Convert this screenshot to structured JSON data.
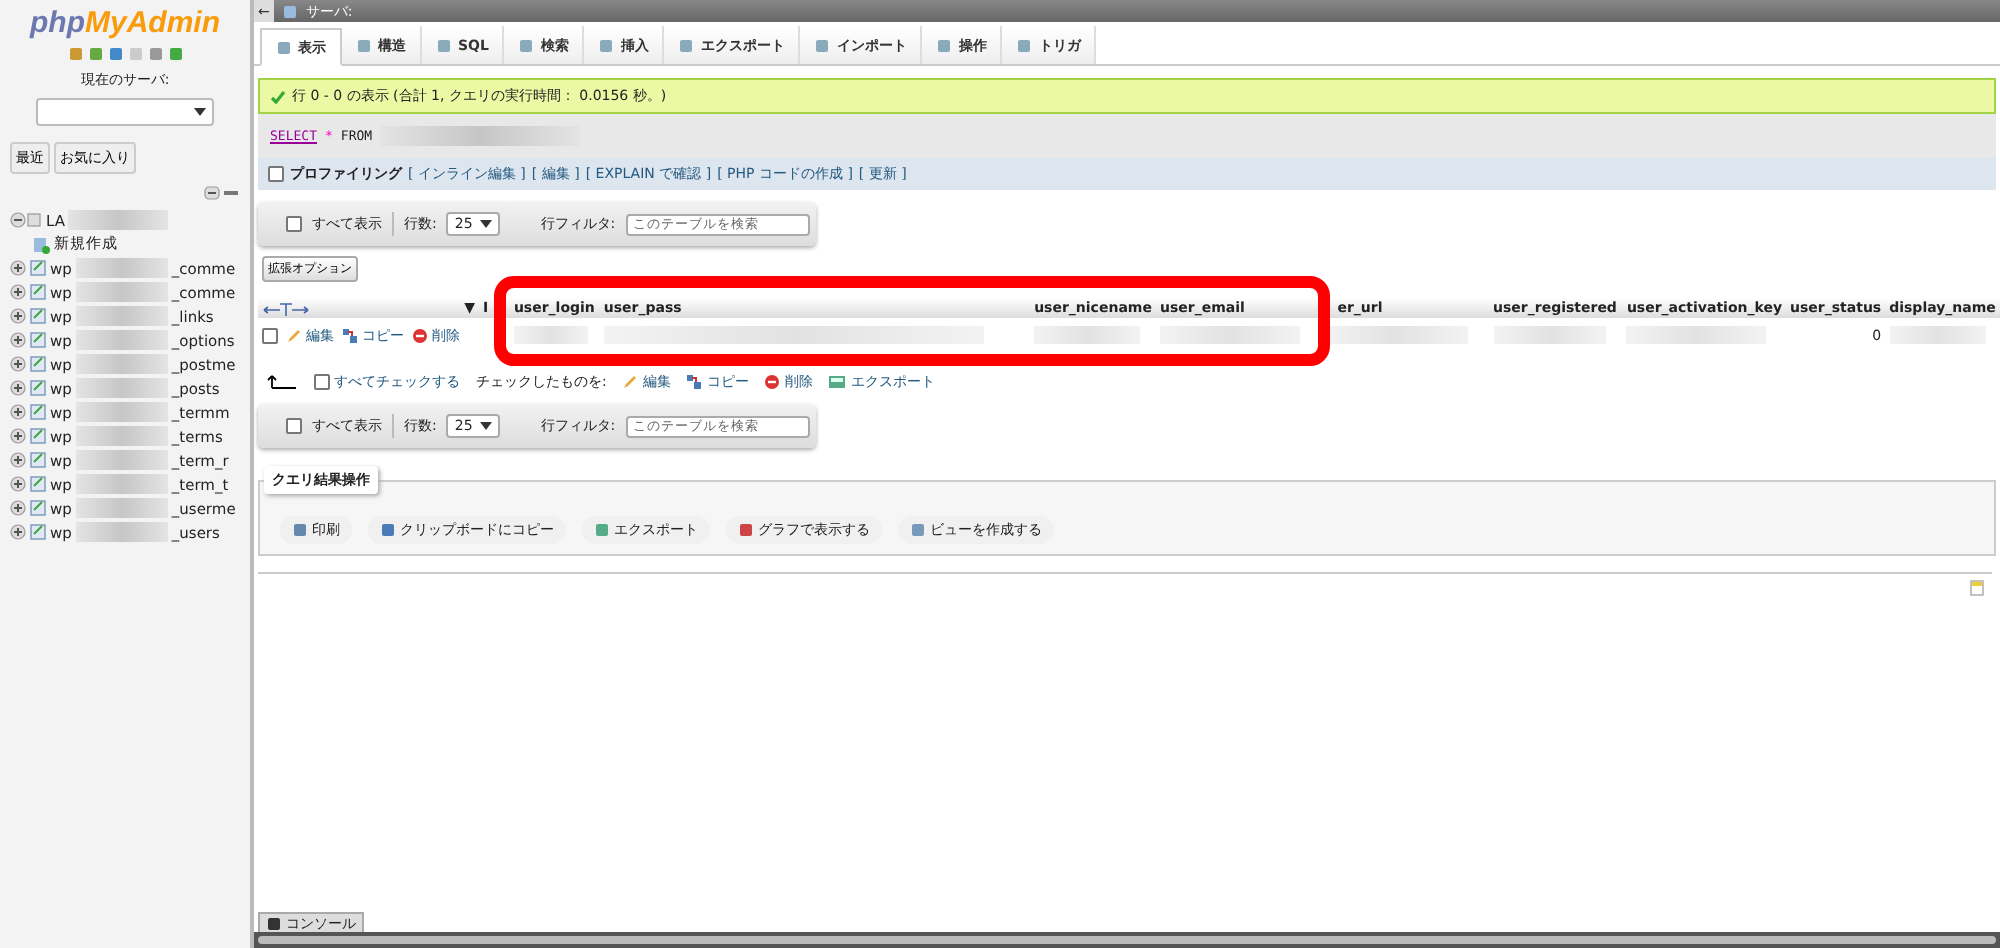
{
  "sidebar": {
    "logo": {
      "php": "php",
      "brand": "MyAdmin"
    },
    "server_label": "現在のサーバ:",
    "buttons": [
      "最近",
      "お気に入り"
    ],
    "tree": {
      "label": "LA",
      "children": [
        {
          "kind": "new",
          "label": "新規作成"
        },
        {
          "kind": "table",
          "prefix": "wp",
          "suffix": "_comme"
        },
        {
          "kind": "table",
          "prefix": "wp",
          "suffix": "_comme"
        },
        {
          "kind": "table",
          "prefix": "wp",
          "suffix": "_links"
        },
        {
          "kind": "table",
          "prefix": "wp",
          "suffix": "_options"
        },
        {
          "kind": "table",
          "prefix": "wp",
          "suffix": "_postme"
        },
        {
          "kind": "table",
          "prefix": "wp",
          "suffix": "_posts"
        },
        {
          "kind": "table",
          "prefix": "wp",
          "suffix": "_termm"
        },
        {
          "kind": "table",
          "prefix": "wp",
          "suffix": "_terms"
        },
        {
          "kind": "table",
          "prefix": "wp",
          "suffix": "_term_r"
        },
        {
          "kind": "table",
          "prefix": "wp",
          "suffix": "_term_t"
        },
        {
          "kind": "table",
          "prefix": "wp",
          "suffix": "_userme"
        },
        {
          "kind": "table",
          "prefix": "wp",
          "suffix": "_users"
        }
      ]
    }
  },
  "topbar": {
    "back": "←",
    "title": "サーバ:"
  },
  "tabs": [
    {
      "label": "表示",
      "selected": true
    },
    {
      "label": "構造",
      "selected": false
    },
    {
      "label": "SQL",
      "selected": false
    },
    {
      "label": "検索",
      "selected": false
    },
    {
      "label": "挿入",
      "selected": false
    },
    {
      "label": "エクスポート",
      "selected": false
    },
    {
      "label": "インポート",
      "selected": false
    },
    {
      "label": "操作",
      "selected": false
    },
    {
      "label": "トリガ",
      "selected": false
    }
  ],
  "message": "行 0 - 0 の表示 (合計 1, クエリの実行時間： 0.0156 秒。)",
  "sql": {
    "select": "SELECT",
    "star": "*",
    "from": "FROM"
  },
  "profiling": {
    "label": "プロファイリング",
    "checked": false,
    "links": [
      "[ インライン編集 ]",
      "[ 編集 ]",
      "[ EXPLAIN で確認 ]",
      "[ PHP コードの作成 ]",
      "[ 更新 ]"
    ]
  },
  "navs": [
    {
      "show_all": "すべて表示",
      "checked": false,
      "rows_label": "行数:",
      "rows": "25",
      "filter_label": "行フィルタ:",
      "filter_placeholder": "このテーブルを検索"
    },
    {
      "show_all": "すべて表示",
      "checked": false,
      "rows_label": "行数:",
      "rows": "25",
      "filter_label": "行フィルタ:",
      "filter_placeholder": "このテーブルを検索"
    }
  ],
  "options_button": "拡張オプション",
  "table": {
    "sort_mark": "▼",
    "columns": [
      "I",
      "user_login",
      "user_pass",
      "user_nicename",
      "user_email",
      "er_url",
      "user_registered",
      "user_activation_key",
      "user_status",
      "display_name"
    ],
    "rows": [
      {
        "checked": false,
        "actions": [
          "編集",
          "コピー",
          "削除"
        ],
        "user_status": "0"
      }
    ]
  },
  "bulk": {
    "check_all": "すべてチェックする",
    "checked": false,
    "with_selected": "チェックしたものを:",
    "actions": [
      "編集",
      "コピー",
      "削除",
      "エクスポート"
    ]
  },
  "query_ops": {
    "legend": "クエリ結果操作",
    "items": [
      "印刷",
      "クリップボードにコピー",
      "エクスポート",
      "グラフで表示する",
      "ビューを作成する"
    ]
  },
  "console": "コンソール"
}
